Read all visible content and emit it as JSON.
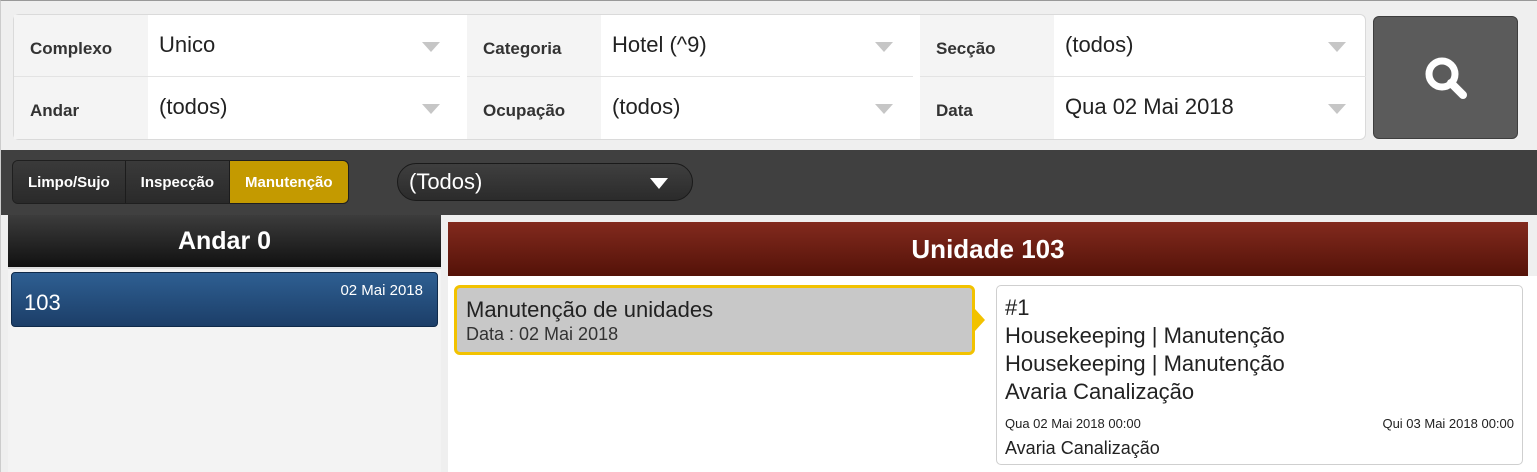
{
  "filters": {
    "complexo": {
      "label": "Complexo",
      "value": "Unico"
    },
    "andar": {
      "label": "Andar",
      "value": "(todos)"
    },
    "categoria": {
      "label": "Categoria",
      "value": "Hotel (^9)"
    },
    "ocupacao": {
      "label": "Ocupação",
      "value": "(todos)"
    },
    "seccao": {
      "label": "Secção",
      "value": "(todos)"
    },
    "data": {
      "label": "Data",
      "value": "Qua 02 Mai 2018"
    }
  },
  "search_icon": "search-icon",
  "toolbar": {
    "tabs": [
      {
        "label": "Limpo/Sujo",
        "active": false
      },
      {
        "label": "Inspecção",
        "active": false
      },
      {
        "label": "Manutenção",
        "active": true
      }
    ],
    "status_filter": "(Todos)",
    "active_color": "#c49a00"
  },
  "floor": {
    "title": "Andar 0",
    "units": [
      {
        "number": "103",
        "date": "02 Mai 2018"
      }
    ]
  },
  "unit_panel": {
    "title": "Unidade 103",
    "header_color": "#6e1f14",
    "request": {
      "title": "Manutenção de unidades",
      "date": "Data : 02 Mai 2018"
    },
    "detail": {
      "id": "#1",
      "line1": "Housekeeping | Manutenção",
      "line2": "Housekeeping | Manutenção",
      "line3": "Avaria Canalização",
      "start": "Qua 02 Mai 2018 00:00",
      "end": "Qui 03 Mai 2018 00:00",
      "footer": "Avaria Canalização"
    }
  }
}
